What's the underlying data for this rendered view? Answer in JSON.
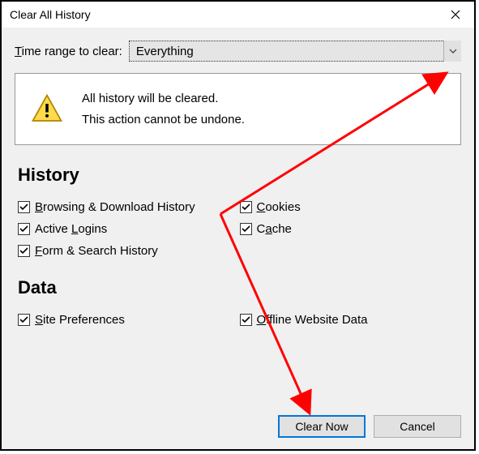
{
  "window": {
    "title": "Clear All History"
  },
  "range": {
    "label_pre": "T",
    "label_post": "ime range to clear:",
    "value": "Everything"
  },
  "warning": {
    "line1": "All history will be cleared.",
    "line2": "This action cannot be undone."
  },
  "sections": {
    "history": {
      "heading": "History",
      "items": {
        "browsing": {
          "u": "B",
          "rest": "rowsing & Download History",
          "checked": true
        },
        "cookies": {
          "u": "C",
          "rest": "ookies",
          "checked": true
        },
        "logins": {
          "pre": "Active ",
          "u": "L",
          "rest": "ogins",
          "checked": true
        },
        "cache": {
          "pre": "C",
          "u": "a",
          "rest": "che",
          "checked": true
        },
        "form": {
          "u": "F",
          "rest": "orm & Search History",
          "checked": true
        }
      }
    },
    "data": {
      "heading": "Data",
      "items": {
        "siteprefs": {
          "u": "S",
          "rest": "ite Preferences",
          "checked": true
        },
        "offline": {
          "u": "O",
          "rest": "ffline Website Data",
          "checked": true
        }
      }
    }
  },
  "buttons": {
    "clear": "Clear Now",
    "cancel": "Cancel"
  },
  "annotation": {
    "color": "#ff0000"
  }
}
